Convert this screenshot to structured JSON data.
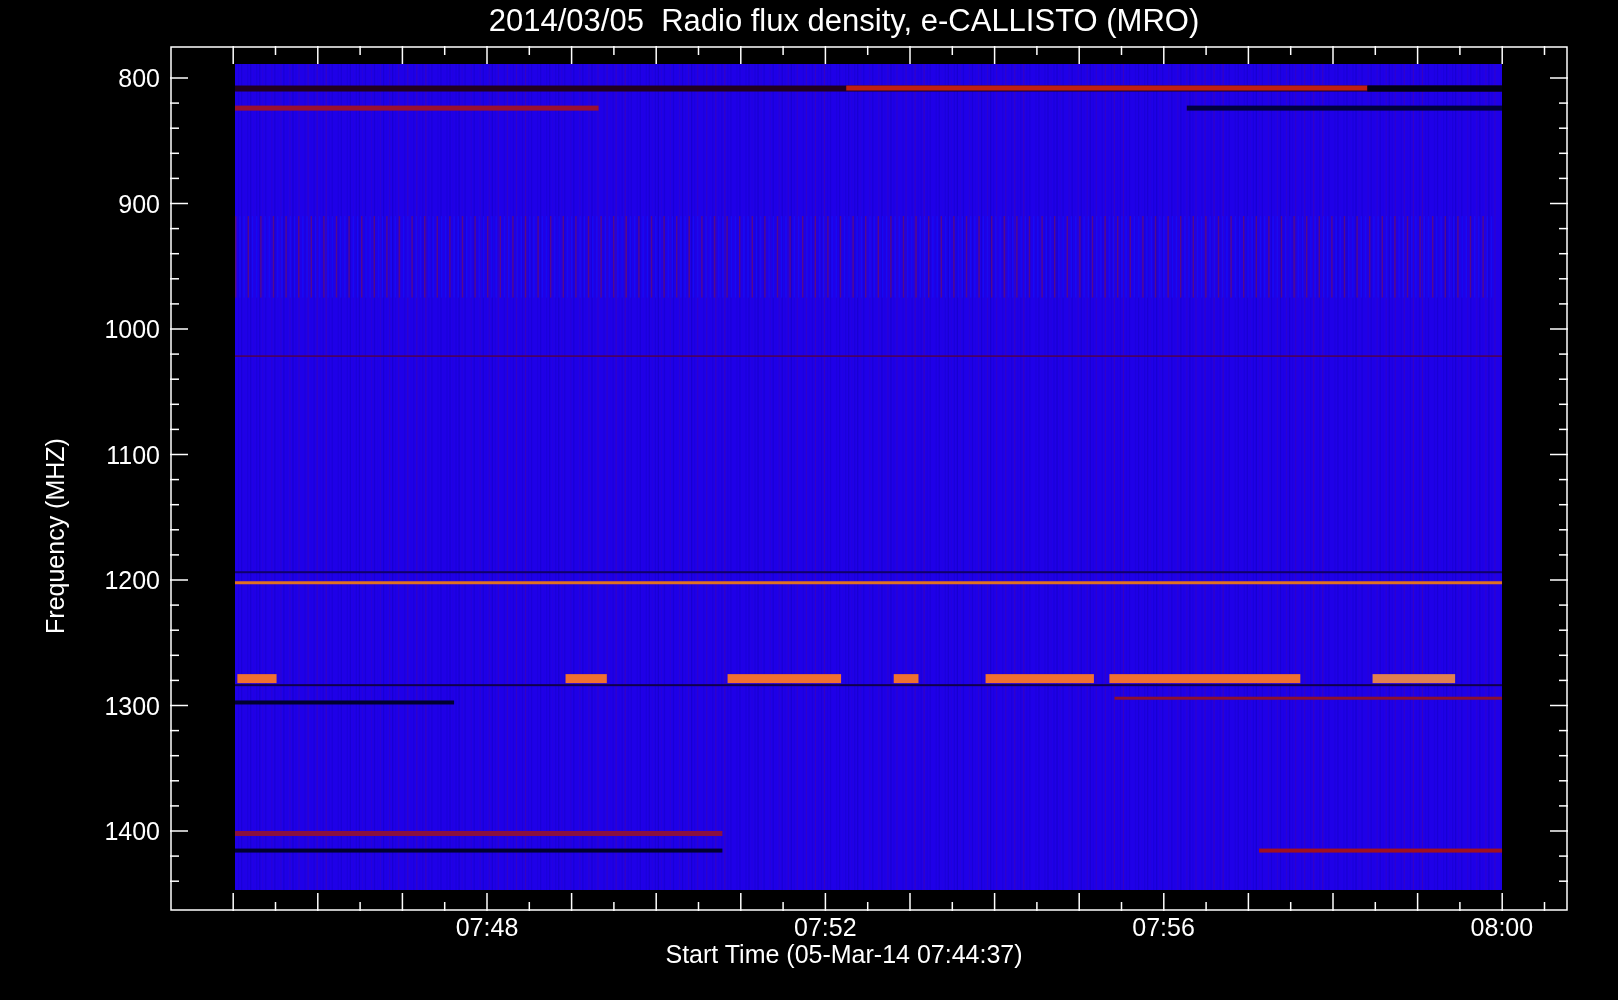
{
  "title": "2014/03/05  Radio flux density, e-CALLISTO (MRO)",
  "y_axis": {
    "label": "Frequency (MHZ)",
    "ticks": [
      "800",
      "900",
      "1000",
      "1100",
      "1200",
      "1300",
      "1400"
    ]
  },
  "x_axis": {
    "label": "Start Time (05-Mar-14 07:44:37)",
    "ticks": [
      "07:48",
      "07:52",
      "07:56",
      "08:00"
    ]
  }
}
